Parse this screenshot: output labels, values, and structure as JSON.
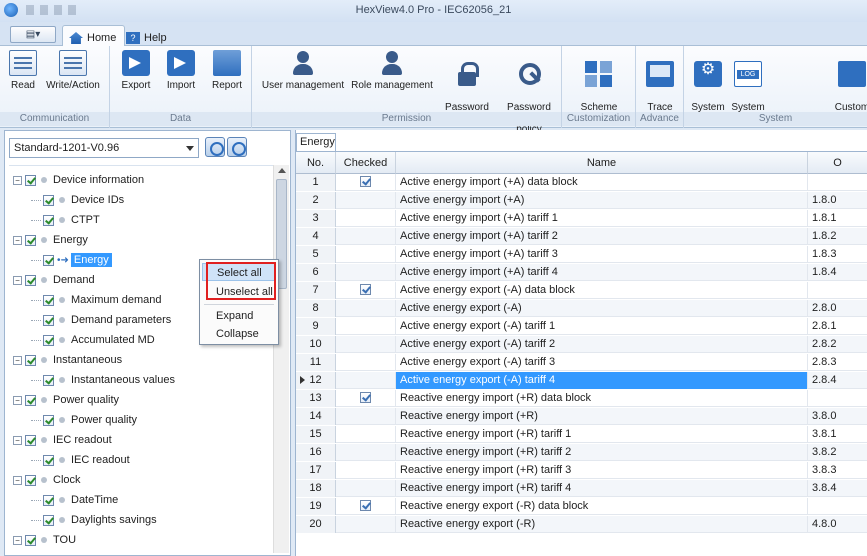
{
  "window": {
    "title": "HexView4.0 Pro - IEC62056_21"
  },
  "tabs": [
    {
      "label": "Home"
    },
    {
      "label": "Help"
    }
  ],
  "ribbon": {
    "groups": [
      {
        "label": "Communication",
        "buttons": [
          "Read",
          "Write/Action"
        ]
      },
      {
        "label": "Data",
        "buttons": [
          "Export",
          "Import",
          "Report"
        ]
      },
      {
        "label": "Permission",
        "buttons": [
          "User management",
          "Role management",
          "Password\nmodification",
          "Password\nsecurity policy"
        ]
      },
      {
        "label": "Customization",
        "buttons": [
          "Scheme\nmanagement"
        ]
      },
      {
        "label": "Advance",
        "buttons": [
          "Trace\nlog"
        ]
      },
      {
        "label": "System",
        "buttons": [
          "System\nsetting",
          "System\nlog",
          "Custom\nlanguage"
        ]
      }
    ]
  },
  "left": {
    "scheme_value": "Standard-1201-V0.96",
    "tree": [
      {
        "label": "Device information",
        "level": 0
      },
      {
        "label": "Device IDs",
        "level": 1
      },
      {
        "label": "CTPT",
        "level": 1
      },
      {
        "label": "Energy",
        "level": 0
      },
      {
        "label": "Energy",
        "level": 1,
        "selected": true
      },
      {
        "label": "Demand",
        "level": 0
      },
      {
        "label": "Maximum demand",
        "level": 1
      },
      {
        "label": "Demand parameters",
        "level": 1
      },
      {
        "label": "Accumulated MD",
        "level": 1
      },
      {
        "label": "Instantaneous",
        "level": 0
      },
      {
        "label": "Instantaneous values",
        "level": 1
      },
      {
        "label": "Power quality",
        "level": 0
      },
      {
        "label": "Power quality",
        "level": 1
      },
      {
        "label": "IEC readout",
        "level": 0
      },
      {
        "label": "IEC readout",
        "level": 1
      },
      {
        "label": "Clock",
        "level": 0
      },
      {
        "label": "DateTime",
        "level": 1
      },
      {
        "label": "Daylights savings",
        "level": 1
      },
      {
        "label": "TOU",
        "level": 0
      }
    ]
  },
  "context_menu": {
    "items": [
      "Select all",
      "Unselect all",
      "Expand",
      "Collapse"
    ]
  },
  "grid": {
    "tab_label": "Energy",
    "headers": {
      "no": "No.",
      "checked": "Checked",
      "name": "Name",
      "code": "O"
    },
    "rows": [
      {
        "no": "1",
        "checked": true,
        "name": "Active energy import (+A) data block",
        "code": ""
      },
      {
        "no": "2",
        "checked": false,
        "name": "Active energy import (+A)",
        "code": "1.8.0"
      },
      {
        "no": "3",
        "checked": false,
        "name": "Active energy import (+A) tariff 1",
        "code": "1.8.1"
      },
      {
        "no": "4",
        "checked": false,
        "name": "Active energy import (+A) tariff 2",
        "code": "1.8.2"
      },
      {
        "no": "5",
        "checked": false,
        "name": "Active energy import (+A) tariff 3",
        "code": "1.8.3"
      },
      {
        "no": "6",
        "checked": false,
        "name": "Active energy import (+A) tariff 4",
        "code": "1.8.4"
      },
      {
        "no": "7",
        "checked": true,
        "name": "Active energy export (-A) data block",
        "code": ""
      },
      {
        "no": "8",
        "checked": false,
        "name": "Active energy export (-A)",
        "code": "2.8.0"
      },
      {
        "no": "9",
        "checked": false,
        "name": "Active energy export (-A) tariff 1",
        "code": "2.8.1"
      },
      {
        "no": "10",
        "checked": false,
        "name": "Active energy export (-A) tariff 2",
        "code": "2.8.2"
      },
      {
        "no": "11",
        "checked": false,
        "name": "Active energy export (-A) tariff 3",
        "code": "2.8.3"
      },
      {
        "no": "12",
        "checked": false,
        "name": "Active energy export (-A) tariff 4",
        "code": "2.8.4",
        "selected": true
      },
      {
        "no": "13",
        "checked": true,
        "name": "Reactive energy import (+R) data block",
        "code": ""
      },
      {
        "no": "14",
        "checked": false,
        "name": "Reactive energy import (+R)",
        "code": "3.8.0"
      },
      {
        "no": "15",
        "checked": false,
        "name": "Reactive energy import (+R)  tariff 1",
        "code": "3.8.1"
      },
      {
        "no": "16",
        "checked": false,
        "name": "Reactive energy import (+R)  tariff 2",
        "code": "3.8.2"
      },
      {
        "no": "17",
        "checked": false,
        "name": "Reactive energy import (+R)  tariff 3",
        "code": "3.8.3"
      },
      {
        "no": "18",
        "checked": false,
        "name": "Reactive energy import (+R)  tariff 4",
        "code": "3.8.4"
      },
      {
        "no": "19",
        "checked": true,
        "name": "Reactive energy export (-R) data block",
        "code": ""
      },
      {
        "no": "20",
        "checked": false,
        "name": "Reactive energy export (-R)",
        "code": "4.8.0"
      }
    ]
  },
  "colors": {
    "selection": "#3399ff",
    "highlight_box": "#e02020",
    "ribbon_accent": "#2f6fbf"
  }
}
